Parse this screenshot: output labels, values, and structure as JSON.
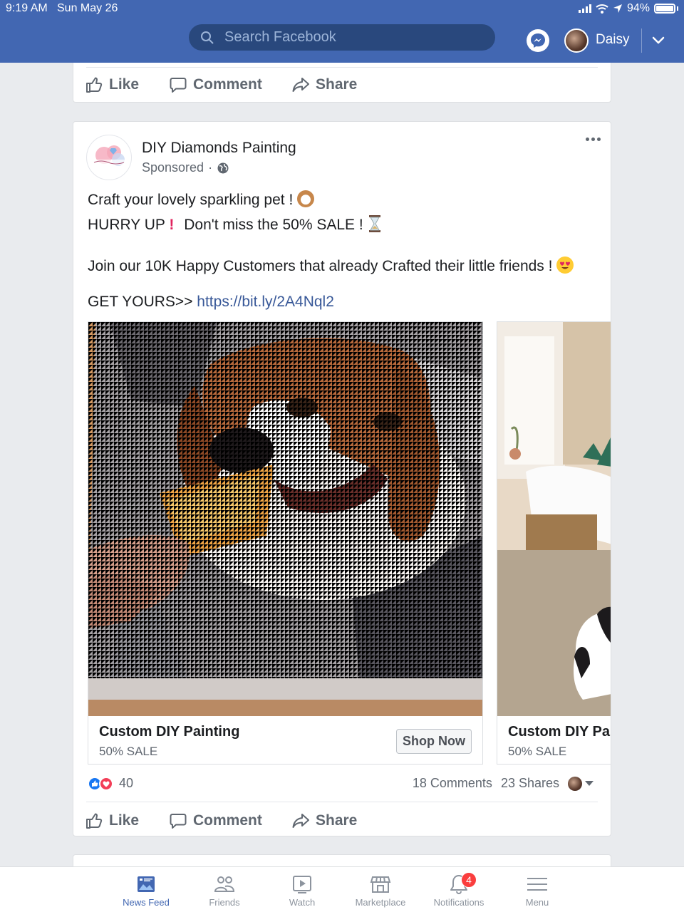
{
  "status_bar": {
    "time": "9:19 AM",
    "date": "Sun May 26",
    "battery": "94%"
  },
  "header": {
    "search_placeholder": "Search Facebook",
    "user_name": "Daisy"
  },
  "prev_post_actions": {
    "like": "Like",
    "comment": "Comment",
    "share": "Share"
  },
  "post": {
    "page_name": "DIY Diamonds Painting",
    "sponsored": "Sponsored",
    "lines": {
      "l1": "Craft your lovely sparkling pet !",
      "l2a": "HURRY UP",
      "l2b": "Don't miss the 50% SALE !",
      "l3": "Join our 10K Happy Customers that already Crafted their little friends !",
      "l4_prefix": "GET YOURS>>",
      "l4_link": "https://bit.ly/2A4Nql2"
    },
    "carousel": [
      {
        "title": "Custom DIY Painting",
        "subtitle": "50% SALE",
        "cta": "Shop Now"
      },
      {
        "title": "Custom DIY Pai",
        "subtitle": "50% SALE"
      }
    ],
    "reactions_count": "40",
    "comments": "18 Comments",
    "shares": "23 Shares",
    "actions": {
      "like": "Like",
      "comment": "Comment",
      "share": "Share"
    }
  },
  "tabbar": {
    "items": [
      {
        "label": "News Feed",
        "icon": "news-feed-icon",
        "active": true
      },
      {
        "label": "Friends",
        "icon": "friends-icon"
      },
      {
        "label": "Watch",
        "icon": "watch-icon"
      },
      {
        "label": "Marketplace",
        "icon": "marketplace-icon"
      },
      {
        "label": "Notifications",
        "icon": "bell-icon",
        "badge": "4"
      },
      {
        "label": "Menu",
        "icon": "menu-icon"
      }
    ]
  },
  "colors": {
    "brand": "#4267b2",
    "link": "#385898",
    "background": "#e9ebee",
    "badge": "#fa3e3e"
  }
}
